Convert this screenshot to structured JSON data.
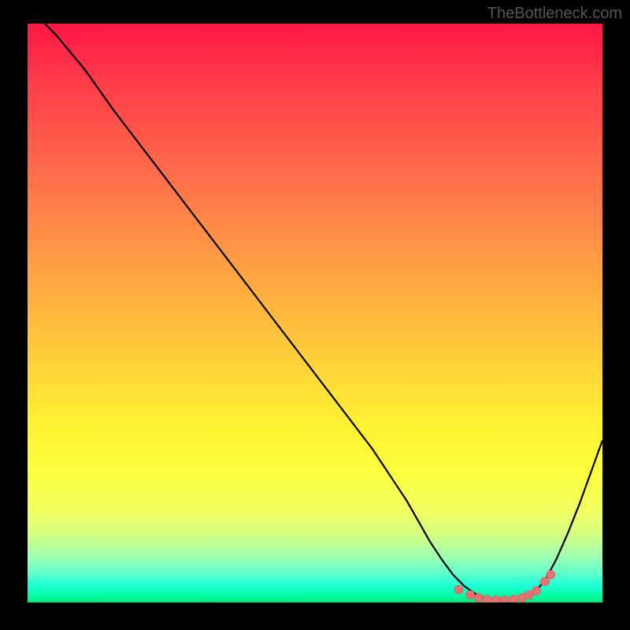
{
  "watermark": "TheBottleneck.com",
  "chart_data": {
    "type": "line",
    "title": "",
    "xlabel": "",
    "ylabel": "",
    "x_range": [
      0,
      100
    ],
    "y_range": [
      0,
      100
    ],
    "curve": {
      "x": [
        0,
        5,
        10,
        15,
        20,
        25,
        30,
        35,
        40,
        45,
        50,
        55,
        60,
        62,
        64,
        66,
        68,
        70,
        72,
        74,
        76,
        78,
        80,
        82,
        84,
        86,
        88,
        90,
        92,
        94,
        96,
        98,
        100
      ],
      "y": [
        103,
        98,
        92,
        85,
        78.5,
        72,
        65.5,
        59,
        52.5,
        46,
        39.5,
        33,
        26.5,
        23.5,
        20.5,
        17.5,
        14,
        10.5,
        7.5,
        4.8,
        2.8,
        1.4,
        0.6,
        0.3,
        0.3,
        0.6,
        1.5,
        3.8,
        7.5,
        12,
        17,
        22.5,
        28
      ]
    },
    "markers": {
      "x": [
        75,
        77,
        78.5,
        80,
        81.5,
        83,
        84.5,
        86,
        87.2,
        88.5,
        90,
        91
      ],
      "y": [
        2.2,
        1.3,
        0.8,
        0.5,
        0.4,
        0.4,
        0.5,
        0.8,
        1.3,
        2.0,
        3.6,
        4.8
      ]
    },
    "gradient_legend": "Background gradient from red (high/bad) at top to green (low/good) at bottom"
  }
}
